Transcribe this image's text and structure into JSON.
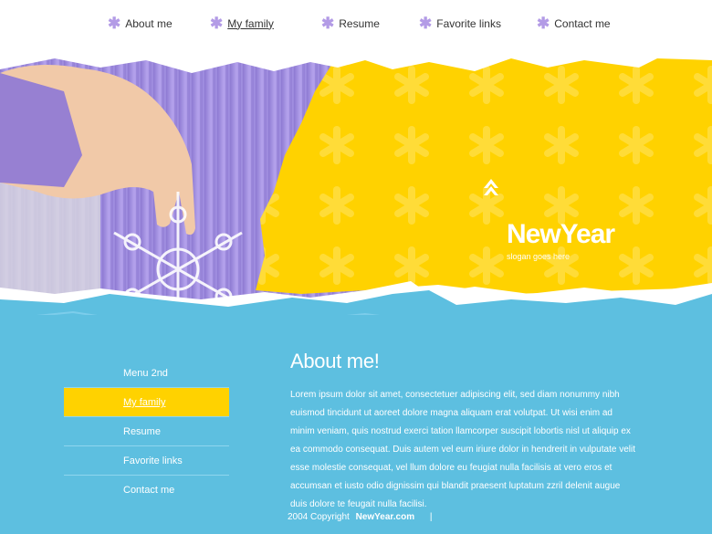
{
  "nav": {
    "items": [
      {
        "label": "About me"
      },
      {
        "label": "My family"
      },
      {
        "label": "Resume"
      },
      {
        "label": "Favorite links"
      },
      {
        "label": "Contact me"
      }
    ]
  },
  "brand": {
    "title": "NewYear",
    "slogan": "slogan goes here"
  },
  "sidebar": {
    "items": [
      {
        "label": "Menu 2nd"
      },
      {
        "label": "My family"
      },
      {
        "label": "Resume"
      },
      {
        "label": "Favorite links"
      },
      {
        "label": "Contact me"
      }
    ]
  },
  "main": {
    "heading": "About me!",
    "body": "Lorem ipsum dolor sit amet, consectetuer adipiscing elit, sed diam nonummy nibh euismod tincidunt ut aoreet dolore magna aliquam erat volutpat. Ut wisi enim ad minim veniam, quis nostrud exerci tation llamcorper suscipit lobortis nisl ut aliquip ex ea commodo consequat. Duis autem vel eum iriure dolor in hendrerit in vulputate velit esse molestie consequat, vel llum dolore eu feugiat nulla facilisis at vero eros et accumsan et iusto odio dignissim qui blandit praesent luptatum zzril delenit augue duis dolore te feugait nulla facilisi."
  },
  "footer": {
    "copyright": "2004 Copyright",
    "site": "NewYear.com",
    "separator": "|"
  },
  "colors": {
    "yellow": "#ffd200",
    "blue": "#5dbfe0",
    "purple": "#9a86d8"
  }
}
